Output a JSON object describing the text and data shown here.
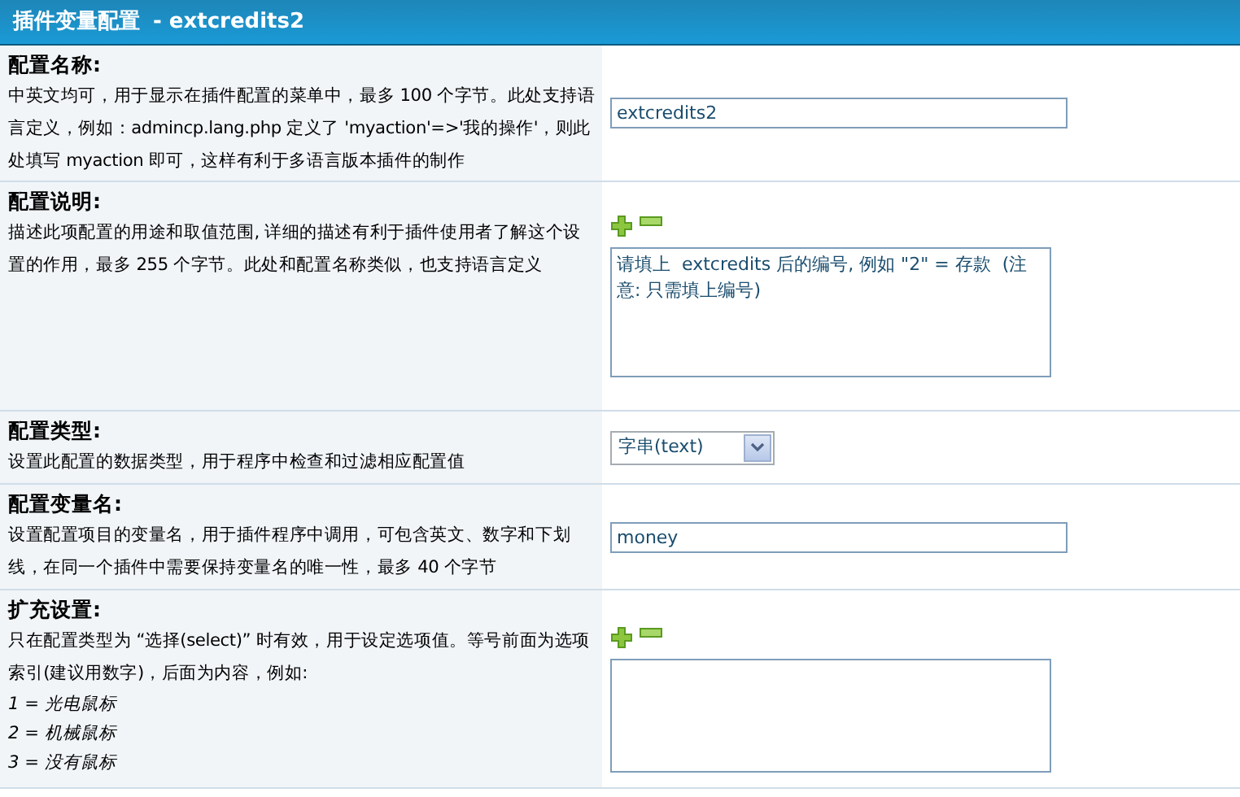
{
  "header": {
    "title": "插件变量配置",
    "subtitle": "- extcredits2"
  },
  "settings": [
    {
      "label": "配置名称:",
      "description": "中英文均可，用于显示在插件配置的菜单中，最多 100 个字节。此处支持语言定义，例如：admincp.lang.php 定义了 'myaction'=>'我的操作'，则此处填写 myaction 即可，这样有利于多语言版本插件的制作",
      "kind": "text",
      "value": "extcredits2",
      "resize_buttons": false
    },
    {
      "label": "配置说明:",
      "description": "描述此项配置的用途和取值范围, 详细的描述有利于插件使用者了解这个设置的作用，最多 255 个字节。此处和配置名称类似，也支持语言定义",
      "kind": "textarea",
      "value": "请填上  extcredits 后的编号, 例如 \"2\" = 存款  (注意: 只需填上编号)",
      "resize_buttons": true
    },
    {
      "label": "配置类型:",
      "description": "设置此配置的数据类型，用于程序中检查和过滤相应配置值",
      "kind": "select",
      "value": "字串(text)",
      "resize_buttons": false
    },
    {
      "label": "配置变量名:",
      "description": "设置配置项目的变量名，用于插件程序中调用，可包含英文、数字和下划线，在同一个插件中需要保持变量名的唯一性，最多 40 个字节",
      "kind": "text",
      "value": "money",
      "resize_buttons": false
    },
    {
      "label": "扩充设置:",
      "description": "只在配置类型为 “选择(select)” 时有效，用于设定选项值。等号前面为选项索引(建议用数字)，后面为内容，例如:",
      "examples": [
        "1 = 光电鼠标",
        "2 = 机械鼠标",
        "3 = 没有鼠标"
      ],
      "kind": "textarea",
      "resize_buttons": true
    }
  ]
}
